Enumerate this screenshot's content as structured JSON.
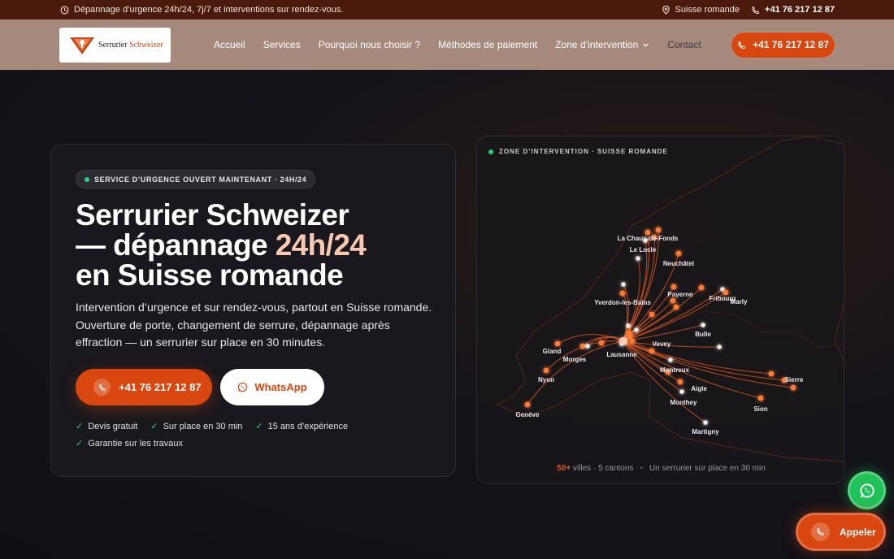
{
  "topbar": {
    "notice": "Dépannage d’urgence 24h/24, 7j/7 et interventions sur rendez-vous.",
    "location": "Suisse romande",
    "phone": "+41 76 217 12 87"
  },
  "nav": {
    "logo_text_1": "Serrurier",
    "logo_text_2": "Schweizer",
    "items": [
      "Accueil",
      "Services",
      "Pourquoi nous choisir ?",
      "Méthodes de paiement",
      "Zone d’intervention",
      "Contact"
    ],
    "cta_phone": "+41 76 217 12 87"
  },
  "hero": {
    "badge": "SERVICE D’URGENCE OUVERT MAINTENANT · 24H/24",
    "title_line1": "Serrurier Schweizer",
    "title_line2_pre": "— dépannage ",
    "title_line2_hl": "24h/24",
    "title_line3": "en Suisse romande",
    "description": "Intervention d’urgence et sur rendez-vous, partout en Suisse romande. Ouverture de porte, changement de serrure, dépannage après effraction — un serrurier sur place en 30 minutes.",
    "btn_call": "+41 76 217 12 87",
    "btn_whatsapp": "WhatsApp",
    "checks": [
      "Devis gratuit",
      "Sur place en 30 min",
      "15 ans d’expérience",
      "Garantie sur les travaux"
    ]
  },
  "map": {
    "heading": "ZONE D’INTERVENTION · SUISSE ROMANDE",
    "cities": [
      "La Chaux-de-Fonds",
      "Le Locle",
      "Neuchâtel",
      "Payerne",
      "Fribourg",
      "Marly",
      "Yverdon-les-Bains",
      "Bulle",
      "Gland",
      "Morges",
      "Lausanne",
      "Vevey",
      "Nyon",
      "Montreux",
      "Aigle",
      "Sierre",
      "Monthey",
      "Sion",
      "Genève",
      "Martigny"
    ],
    "foot_count": "50+",
    "foot_count_label": "villes · 5 cantons",
    "foot_tagline": "Un serrurier sur place en 30 min",
    "accent_color": "#e25a1c"
  },
  "floating": {
    "call_label": "Appeler"
  }
}
